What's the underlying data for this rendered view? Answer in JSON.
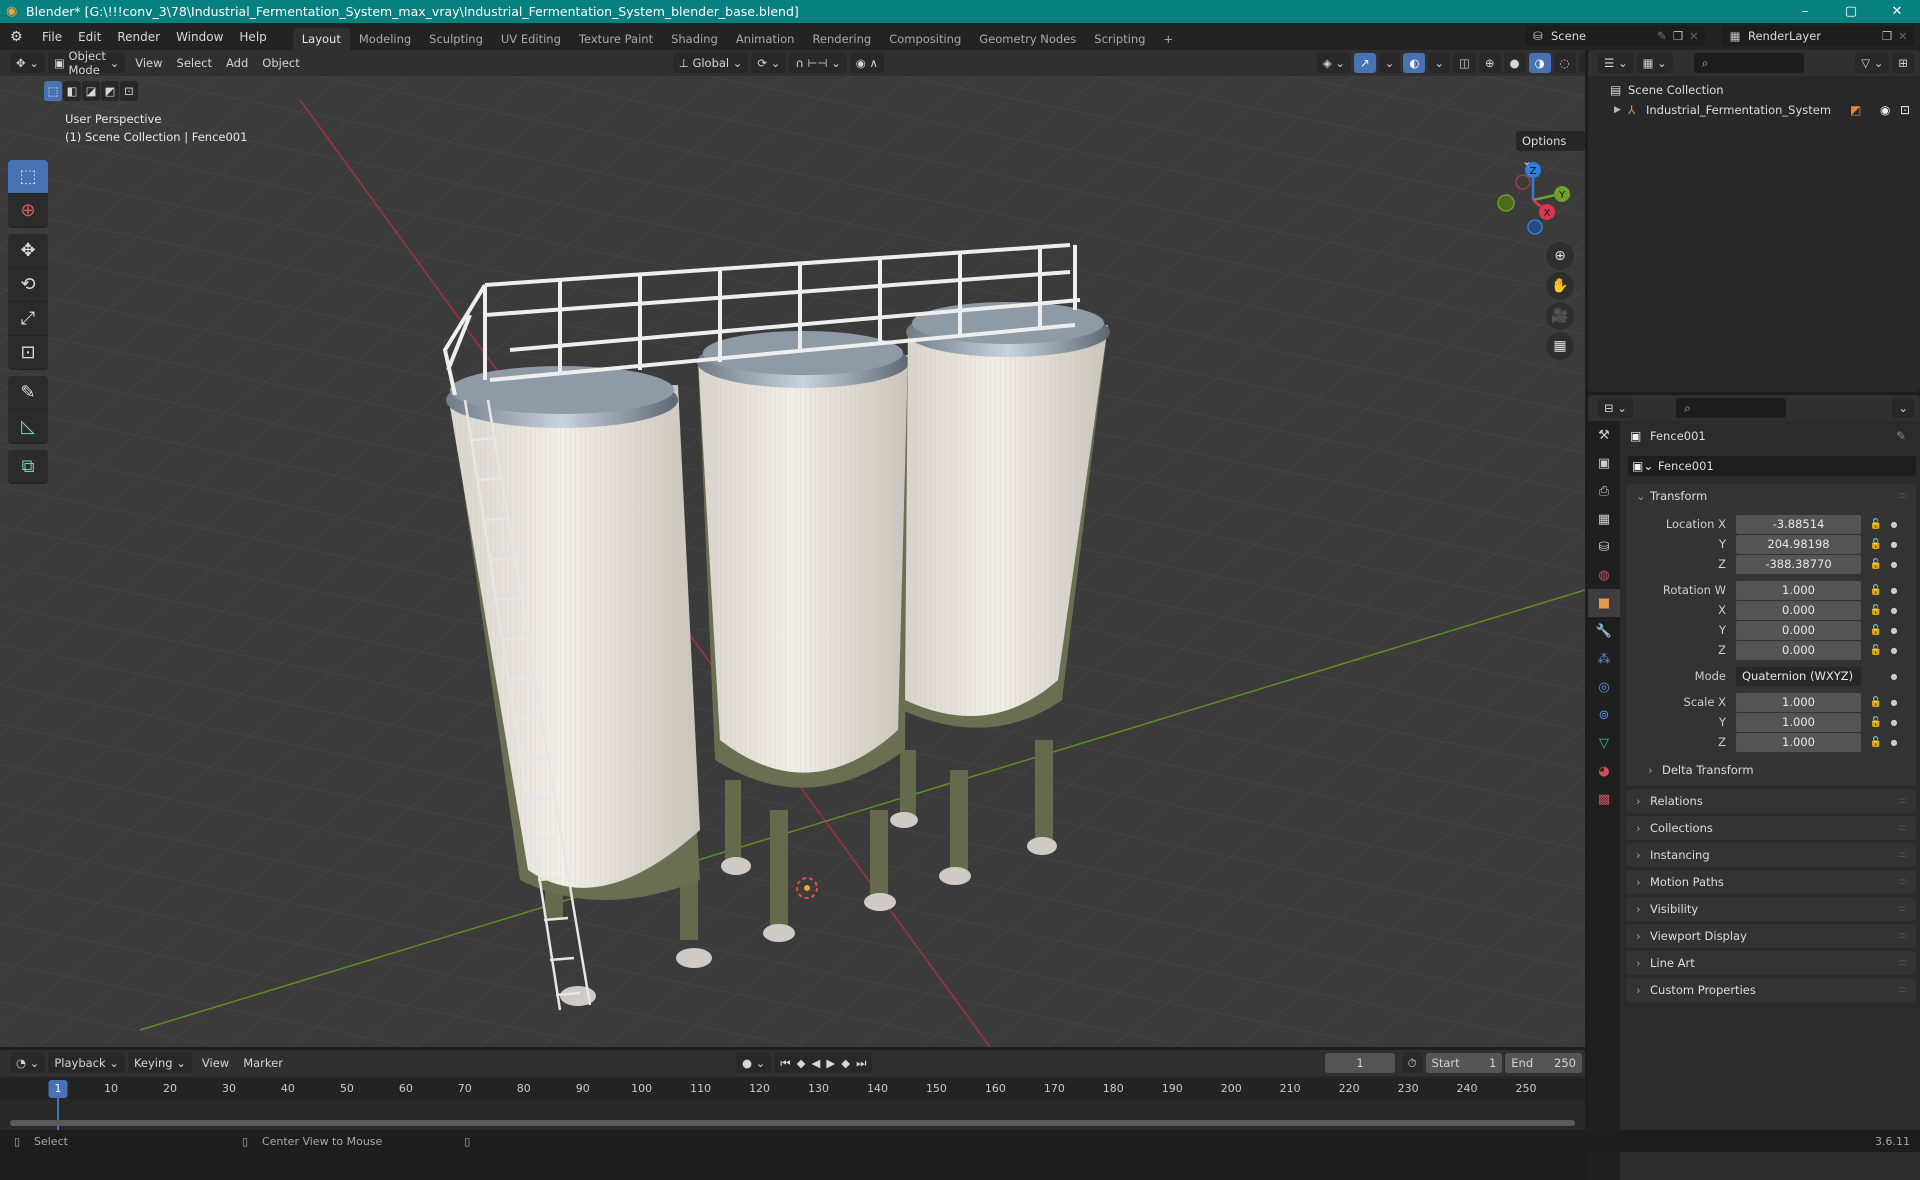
{
  "window": {
    "title": "Blender* [G:\\!!!conv_3\\78\\Industrial_Fermentation_System_max_vray\\Industrial_Fermentation_System_blender_base.blend]",
    "controls": {
      "minimize": "–",
      "maximize": "▢",
      "close": "✕"
    }
  },
  "menubar": {
    "menus": [
      "File",
      "Edit",
      "Render",
      "Window",
      "Help"
    ],
    "workspaces": [
      "Layout",
      "Modeling",
      "Sculpting",
      "UV Editing",
      "Texture Paint",
      "Shading",
      "Animation",
      "Rendering",
      "Compositing",
      "Geometry Nodes",
      "Scripting"
    ],
    "active_workspace": "Layout",
    "add_workspace": "+",
    "scene": "Scene",
    "view_layer": "RenderLayer"
  },
  "viewport": {
    "mode": "Object Mode",
    "menus": [
      "View",
      "Select",
      "Add",
      "Object"
    ],
    "transform_orientation": "Global",
    "options_label": "Options",
    "view_name": "User Perspective",
    "context": "(1) Scene Collection | Fence001",
    "gizmo_axes": {
      "x": "X",
      "y": "Y",
      "z": "Z"
    },
    "colors": {
      "x_axis": "#d9364f",
      "y_axis": "#6ea125",
      "z_axis": "#2f7fdc",
      "accent": "#4772b3"
    },
    "tools": [
      "select-box",
      "cursor",
      "move",
      "rotate",
      "scale",
      "transform",
      "annotate",
      "measure",
      "add-cube"
    ]
  },
  "outliner": {
    "root": "Scene Collection",
    "items": [
      {
        "name": "Industrial_Fermentation_System",
        "type": "empty"
      }
    ]
  },
  "properties": {
    "object_name": "Fence001",
    "datablock_name": "Fence001",
    "transform": {
      "title": "Transform",
      "location": {
        "label": "Location X",
        "x": "-3.88514",
        "y": "204.98198",
        "z": "-388.38770"
      },
      "rotation": {
        "label": "Rotation W",
        "w": "1.000",
        "x": "0.000",
        "y": "0.000",
        "z": "0.000"
      },
      "mode_label": "Mode",
      "mode": "Quaternion (WXYZ)",
      "scale": {
        "label": "Scale X",
        "x": "1.000",
        "y": "1.000",
        "z": "1.000"
      },
      "axis_labels": {
        "x": "X",
        "y": "Y",
        "z": "Z"
      },
      "delta": "Delta Transform"
    },
    "panels": [
      "Relations",
      "Collections",
      "Instancing",
      "Motion Paths",
      "Visibility",
      "Viewport Display",
      "Line Art",
      "Custom Properties"
    ]
  },
  "timeline": {
    "menus": [
      "Playback",
      "Keying",
      "View",
      "Marker"
    ],
    "current_frame": "1",
    "start_label": "Start",
    "start": "1",
    "end_label": "End",
    "end": "250",
    "ticks": [
      "10",
      "20",
      "30",
      "40",
      "50",
      "60",
      "70",
      "80",
      "90",
      "100",
      "110",
      "120",
      "130",
      "140",
      "150",
      "160",
      "170",
      "180",
      "190",
      "200",
      "210",
      "220",
      "230",
      "240",
      "250"
    ]
  },
  "statusbar": {
    "select": "Select",
    "center": "Center View to Mouse",
    "version": "3.6.11"
  }
}
